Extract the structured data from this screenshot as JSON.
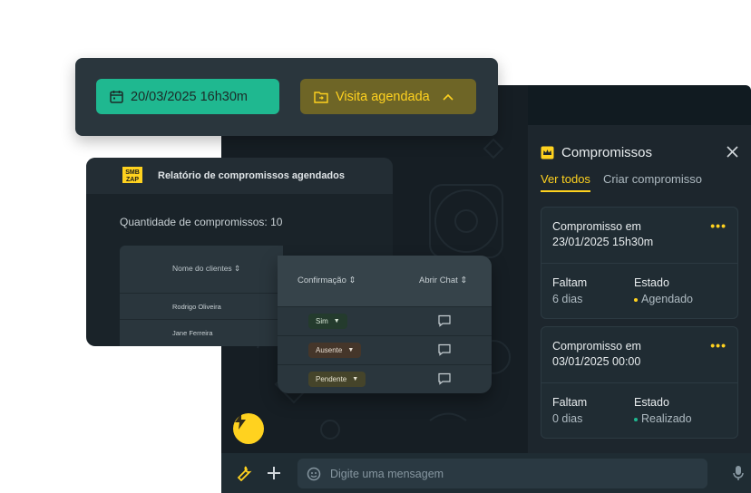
{
  "toolbar": {
    "date_label": "20/03/2025 16h30m",
    "status_label": "Visita agendada"
  },
  "report": {
    "logo_text": "SMB ZAP",
    "title": "Relatório de compromissos agendados",
    "quantity_text": "Quantidade  de compromissos: 10",
    "columns": {
      "name": "Nome do clientes",
      "confirmation": "Confirmação",
      "open_chat": "Abrir Chat"
    },
    "rows": [
      {
        "name": "Rodrigo Oliveira",
        "confirmation": "Sim"
      },
      {
        "name": "Jane Ferreira",
        "confirmation": "Ausente"
      },
      {
        "name": "",
        "confirmation": "Pendente"
      }
    ]
  },
  "panel": {
    "title": "Compromissos",
    "tabs": [
      "Ver todos",
      "Criar compromisso"
    ],
    "cards": [
      {
        "title": "Compromisso em",
        "datetime": "23/01/2025 15h30m",
        "remaining_label": "Faltam",
        "remaining_value": "6 dias",
        "state_label": "Estado",
        "state_value": "Agendado",
        "state_color": "#ffd21f"
      },
      {
        "title": "Compromisso em",
        "datetime": "03/01/2025 00:00",
        "remaining_label": "Faltam",
        "remaining_value": "0 dias",
        "state_label": "Estado",
        "state_value": "Realizado",
        "state_color": "#1fb890"
      }
    ]
  },
  "composer": {
    "placeholder": "Digite uma mensagem"
  },
  "colors": {
    "accent": "#ffd21f",
    "green": "#1fb890",
    "olive": "#6e6526"
  },
  "icons": [
    "calendar-icon",
    "folder-icon",
    "chevron-up-icon",
    "crown-icon",
    "close-icon",
    "more-icon",
    "bolt-icon",
    "wrench-icon",
    "plus-icon",
    "sticker-icon",
    "mic-icon",
    "chat-icon",
    "sort-icon",
    "chevron-down-icon"
  ]
}
